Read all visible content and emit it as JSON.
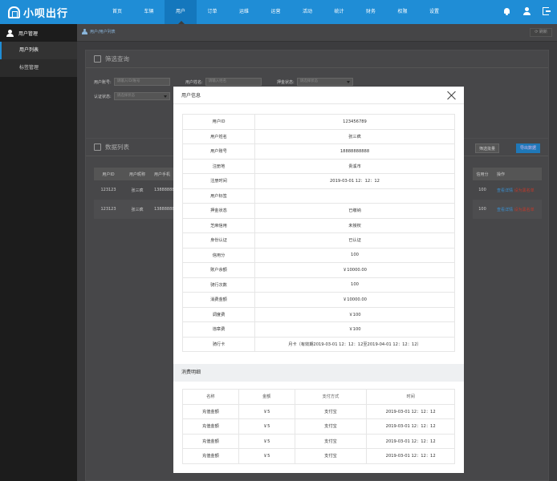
{
  "app": {
    "title": "小呗出行"
  },
  "nav": [
    "首页",
    "车辆",
    "用户",
    "订单",
    "运维",
    "运营",
    "活动",
    "统计",
    "财务",
    "权限",
    "设置"
  ],
  "nav_active": 2,
  "sidebar": {
    "header": "用户管理",
    "items": [
      {
        "label": "用户列表",
        "active": true
      },
      {
        "label": "标签管理",
        "active": false
      }
    ]
  },
  "breadcrumb": "用户/用户列表",
  "refresh_label": "刷新",
  "filter": {
    "title": "筛选查询",
    "fields": [
      {
        "label": "用户账号:",
        "placeholder": "请输入ID/账号"
      },
      {
        "label": "用户姓名:",
        "placeholder": "请输入姓名"
      },
      {
        "label": "押金状态:",
        "placeholder": "请选择状态"
      },
      {
        "label": "认证状态:",
        "placeholder": "请选择状态"
      }
    ]
  },
  "datalist": {
    "title": "数据列表",
    "batch_button": "筛选批量",
    "export_button": "导出数据",
    "columns": [
      "用户ID",
      "用户昵称",
      "用户手机",
      "信用分",
      "操作"
    ],
    "rows": [
      {
        "id": "123123",
        "name": "张三疯",
        "phone": "13888888",
        "credit": "100",
        "view": "查看详情",
        "black": "设为黑名单"
      },
      {
        "id": "123123",
        "name": "张三疯",
        "phone": "13888888",
        "credit": "100",
        "view": "查看详情",
        "black": "设为黑名单"
      }
    ]
  },
  "modal": {
    "title": "用户信息",
    "info": [
      {
        "k": "用户ID",
        "v": "123456789"
      },
      {
        "k": "用户姓名",
        "v": "张三疯"
      },
      {
        "k": "用户账号",
        "v": "18888888888"
      },
      {
        "k": "注册地",
        "v": "贵溪市"
      },
      {
        "k": "注册时间",
        "v": "2019-03-01 12：12：12"
      },
      {
        "k": "用户标签",
        "v": ""
      },
      {
        "k": "押金状态",
        "v": "已缴纳"
      },
      {
        "k": "芝麻信用",
        "v": "未授权"
      },
      {
        "k": "身份认证",
        "v": "已认证"
      },
      {
        "k": "信用分",
        "v": "100"
      },
      {
        "k": "账户余额",
        "v": "￥10000.00"
      },
      {
        "k": "骑行次数",
        "v": "100"
      },
      {
        "k": "消费金额",
        "v": "￥10000.00"
      },
      {
        "k": "调度费",
        "v": "￥100"
      },
      {
        "k": "违章费",
        "v": "￥100"
      },
      {
        "k": "骑行卡",
        "v": "月卡（有效期2019-03-01 12：12：12至2019-04-01 12：12：12）"
      }
    ],
    "consumption_title": "消费明细",
    "consumption_columns": [
      "名称",
      "金额",
      "支付方式",
      "时间"
    ],
    "consumption_rows": [
      [
        "充值金额",
        "￥5",
        "支付宝",
        "2019-03-01 12：12：12"
      ],
      [
        "充值金额",
        "￥5",
        "支付宝",
        "2019-03-01 12：12：12"
      ],
      [
        "充值金额",
        "￥5",
        "支付宝",
        "2019-03-01 12：12：12"
      ],
      [
        "充值金额",
        "￥5",
        "支付宝",
        "2019-03-01 12：12：12"
      ]
    ]
  }
}
